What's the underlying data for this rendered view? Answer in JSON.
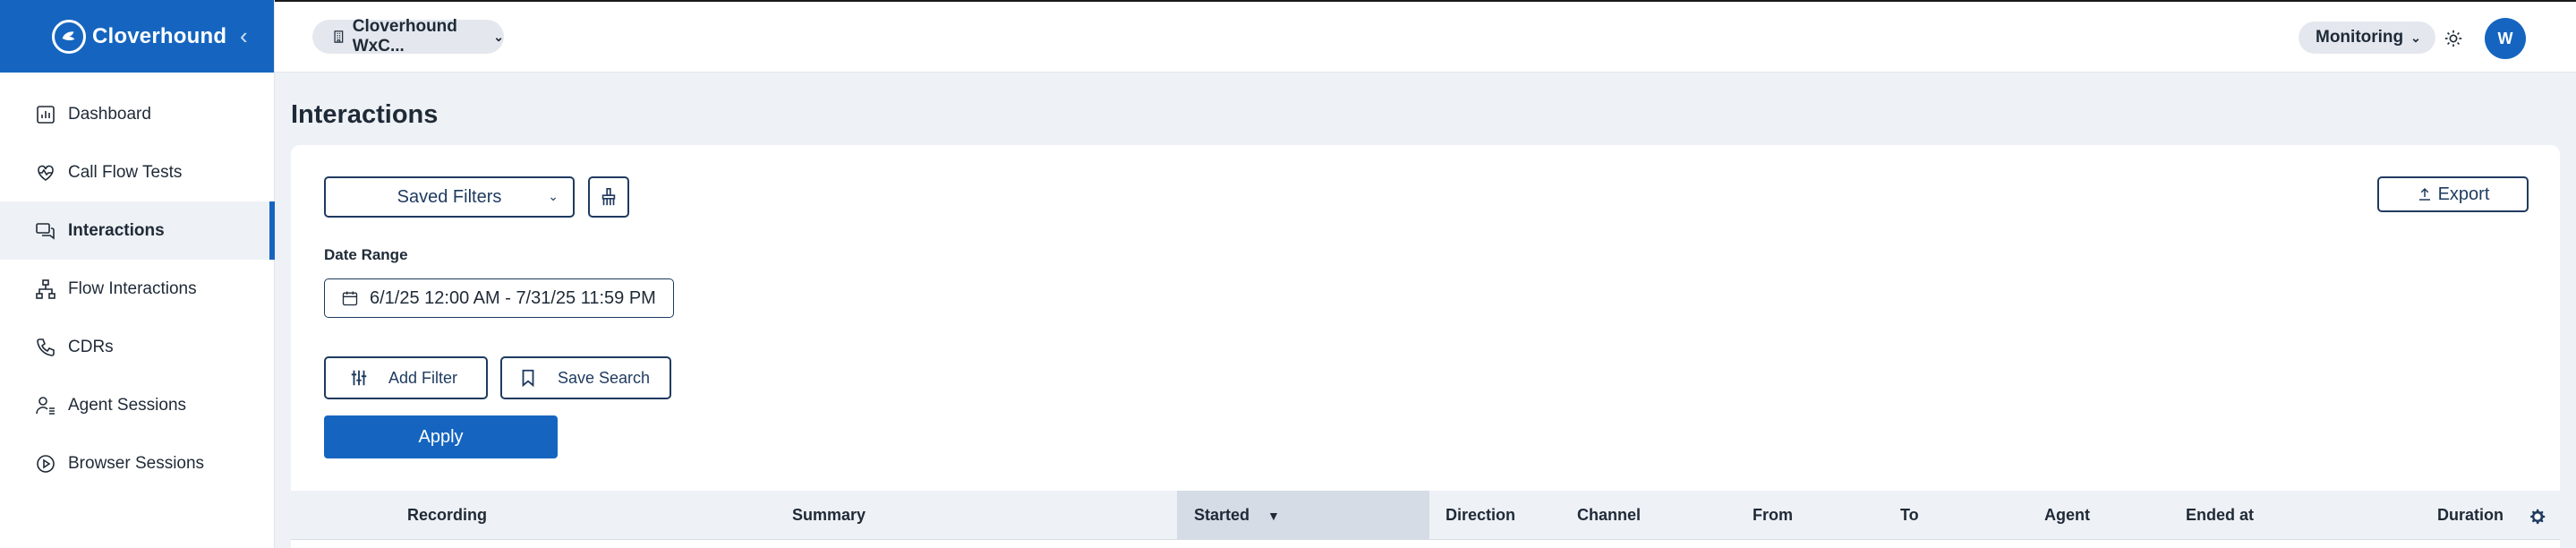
{
  "brand": {
    "name": "Cloverhound",
    "logo_icon": "cloverhound-logo-icon",
    "collapse_icon": "chevron-left-icon"
  },
  "sidebar": {
    "items": [
      {
        "label": "Dashboard",
        "icon": "bar-chart-icon",
        "active": false
      },
      {
        "label": "Call Flow Tests",
        "icon": "heart-pulse-icon",
        "active": false
      },
      {
        "label": "Interactions",
        "icon": "chat-bubbles-icon",
        "active": true
      },
      {
        "label": "Flow Interactions",
        "icon": "flow-tree-icon",
        "active": false
      },
      {
        "label": "CDRs",
        "icon": "phone-icon",
        "active": false
      },
      {
        "label": "Agent Sessions",
        "icon": "agent-list-icon",
        "active": false
      },
      {
        "label": "Browser Sessions",
        "icon": "play-circle-icon",
        "active": false
      }
    ]
  },
  "header": {
    "org_selector": "Cloverhound WxC...",
    "mode_selector": "Monitoring",
    "theme_icon": "sun-icon",
    "avatar_initial": "W"
  },
  "main": {
    "title": "Interactions",
    "saved_filters_label": "Saved Filters",
    "clear_icon": "broom-icon",
    "export_label": "Export",
    "date_range_label": "Date Range",
    "date_range_value": "6/1/25 12:00 AM - 7/31/25 11:59 PM",
    "add_filter_label": "Add Filter",
    "save_search_label": "Save Search",
    "apply_label": "Apply"
  },
  "table": {
    "columns": [
      "Recording",
      "Summary",
      "Started",
      "Direction",
      "Channel",
      "From",
      "To",
      "Agent",
      "Ended at",
      "Duration"
    ],
    "sorted_column": "Started",
    "sort_direction": "descending",
    "settings_icon": "gear-icon"
  },
  "colors": {
    "accent": "#1565c0",
    "outline": "#1e3a5f",
    "background": "#eef1f5"
  }
}
